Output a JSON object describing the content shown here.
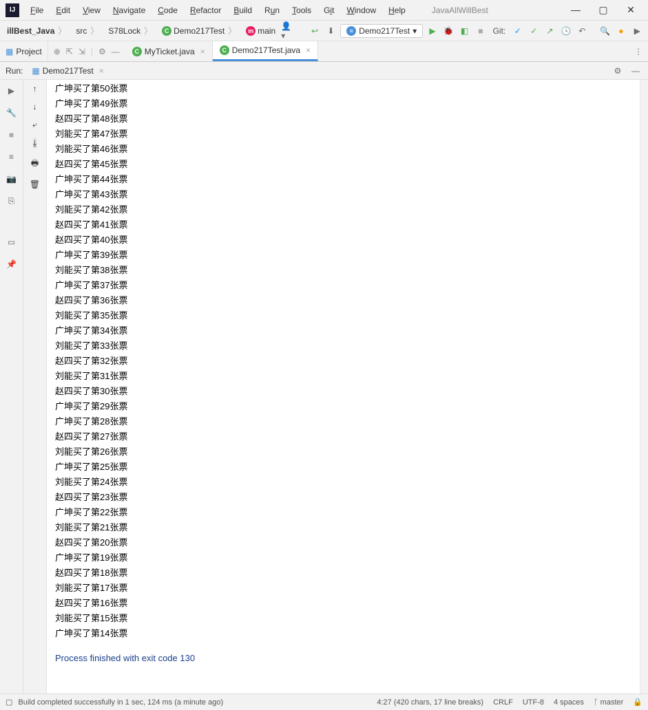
{
  "window": {
    "title": "JavaAllWillBest"
  },
  "menu": {
    "file": "File",
    "edit": "Edit",
    "view": "View",
    "navigate": "Navigate",
    "code": "Code",
    "refactor": "Refactor",
    "build": "Build",
    "run": "Run",
    "tools": "Tools",
    "git": "Git",
    "window": "Window",
    "help": "Help"
  },
  "breadcrumb": {
    "root": "illBest_Java",
    "src": "src",
    "pkg": "S78Lock",
    "class": "Demo217Test",
    "method": "main"
  },
  "run_config": {
    "selected": "Demo217Test",
    "git_label": "Git:"
  },
  "project_panel": {
    "label": "Project"
  },
  "tabs": {
    "t1": "MyTicket.java",
    "t2": "Demo217Test.java"
  },
  "run_panel": {
    "label": "Run:",
    "tab": "Demo217Test"
  },
  "console": {
    "lines": [
      "广坤买了第50张票",
      "广坤买了第49张票",
      "赵四买了第48张票",
      "刘能买了第47张票",
      "刘能买了第46张票",
      "赵四买了第45张票",
      "广坤买了第44张票",
      "广坤买了第43张票",
      "刘能买了第42张票",
      "赵四买了第41张票",
      "赵四买了第40张票",
      "广坤买了第39张票",
      "刘能买了第38张票",
      "广坤买了第37张票",
      "赵四买了第36张票",
      "刘能买了第35张票",
      "广坤买了第34张票",
      "刘能买了第33张票",
      "赵四买了第32张票",
      "刘能买了第31张票",
      "赵四买了第30张票",
      "广坤买了第29张票",
      "广坤买了第28张票",
      "赵四买了第27张票",
      "刘能买了第26张票",
      "广坤买了第25张票",
      "刘能买了第24张票",
      "赵四买了第23张票",
      "广坤买了第22张票",
      "刘能买了第21张票",
      "赵四买了第20张票",
      "广坤买了第19张票",
      "赵四买了第18张票",
      "刘能买了第17张票",
      "赵四买了第16张票",
      "刘能买了第15张票",
      "广坤买了第14张票"
    ],
    "exit": "Process finished with exit code 130"
  },
  "status": {
    "build": "Build completed successfully in 1 sec, 124 ms (a minute ago)",
    "pos": "4:27 (420 chars, 17 line breaks)",
    "eol": "CRLF",
    "enc": "UTF-8",
    "indent": "4 spaces",
    "branch": "master"
  }
}
